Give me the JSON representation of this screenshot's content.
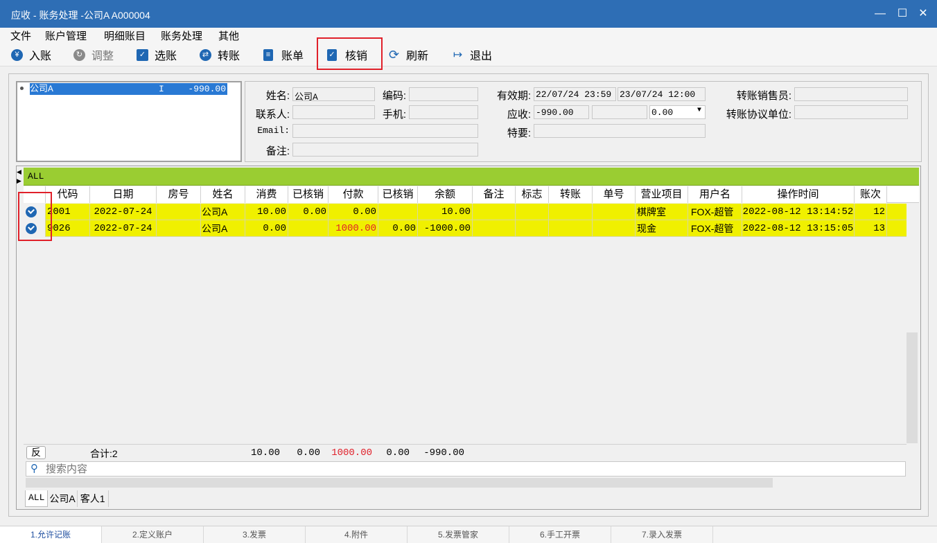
{
  "window": {
    "title": "应收 - 账务处理 -公司A  A000004"
  },
  "menu": [
    "文件",
    "账户管理",
    "明细账目",
    "账务处理",
    "其他"
  ],
  "toolbar": {
    "post": "入账",
    "adjust": "调整",
    "select": "选账",
    "transfer": "转账",
    "bill": "账单",
    "writeoff": "核销",
    "refresh": "刷新",
    "exit": "退出"
  },
  "account_list": [
    {
      "name": "公司A",
      "flag": "I",
      "balance": "-990.00"
    }
  ],
  "info": {
    "name_label": "姓名:",
    "name": "公司A",
    "code_label": "编码:",
    "code": "",
    "contact_label": "联系人:",
    "contact": "",
    "phone_label": "手机:",
    "phone": "",
    "email_label": "Email:",
    "email": "",
    "note_label": "备注:",
    "note": "",
    "valid_label": "有效期:",
    "valid_from": "22/07/24 23:59",
    "valid_to": "23/07/24 12:00",
    "receivable_label": "应收:",
    "receivable": "-990.00",
    "receivable2": "",
    "receivable3": "0.00",
    "special_label": "特要:",
    "special": "",
    "transfer_sales_label": "转账销售员:",
    "transfer_sales": "",
    "transfer_unit_label": "转账协议单位:",
    "transfer_unit": ""
  },
  "grid": {
    "group": "ALL",
    "columns": [
      "代码",
      "日期",
      "房号",
      "姓名",
      "消费",
      "已核销",
      "付款",
      "已核销",
      "余额",
      "备注",
      "标志",
      "转账",
      "单号",
      "营业项目",
      "用户名",
      "操作时间",
      "账次"
    ],
    "rows": [
      {
        "code": "2001",
        "date": "2022-07-24",
        "room": "",
        "name": "公司A",
        "charge": "10.00",
        "written1": "0.00",
        "payment": "0.00",
        "written2": "",
        "balance": "10.00",
        "note": "",
        "flag": "",
        "transfer": "",
        "bill_no": "",
        "item": "棋牌室",
        "user": "FOX-超管",
        "optime": "2022-08-12 13:14:52",
        "seq": "12"
      },
      {
        "code": "9026",
        "date": "2022-07-24",
        "room": "",
        "name": "公司A",
        "charge": "0.00",
        "written1": "",
        "payment": "1000.00",
        "written2": "0.00",
        "balance": "-1000.00",
        "note": "",
        "flag": "",
        "transfer": "",
        "bill_no": "",
        "item": "现金",
        "user": "FOX-超管",
        "optime": "2022-08-12 13:15:05",
        "seq": "13"
      }
    ],
    "footer": {
      "reverse": "反",
      "total": "合计:2",
      "charge": "10.00",
      "written1": "0.00",
      "payment": "1000.00",
      "written2": "0.00",
      "balance": "-990.00"
    },
    "search_placeholder": "搜索内容"
  },
  "tabs": [
    "ALL",
    "公司A",
    "客人1"
  ],
  "bottom_tabs": [
    "1.允许记账",
    "2.定义账户",
    "3.发票",
    "4.附件",
    "5.发票管家",
    "6.手工开票",
    "7.录入发票"
  ],
  "colors": {
    "titlebar": "#2e6eb5",
    "row": "#f0f000",
    "group": "#9acd32",
    "accent": "#1f67b3",
    "highlight": "#e0202a"
  }
}
